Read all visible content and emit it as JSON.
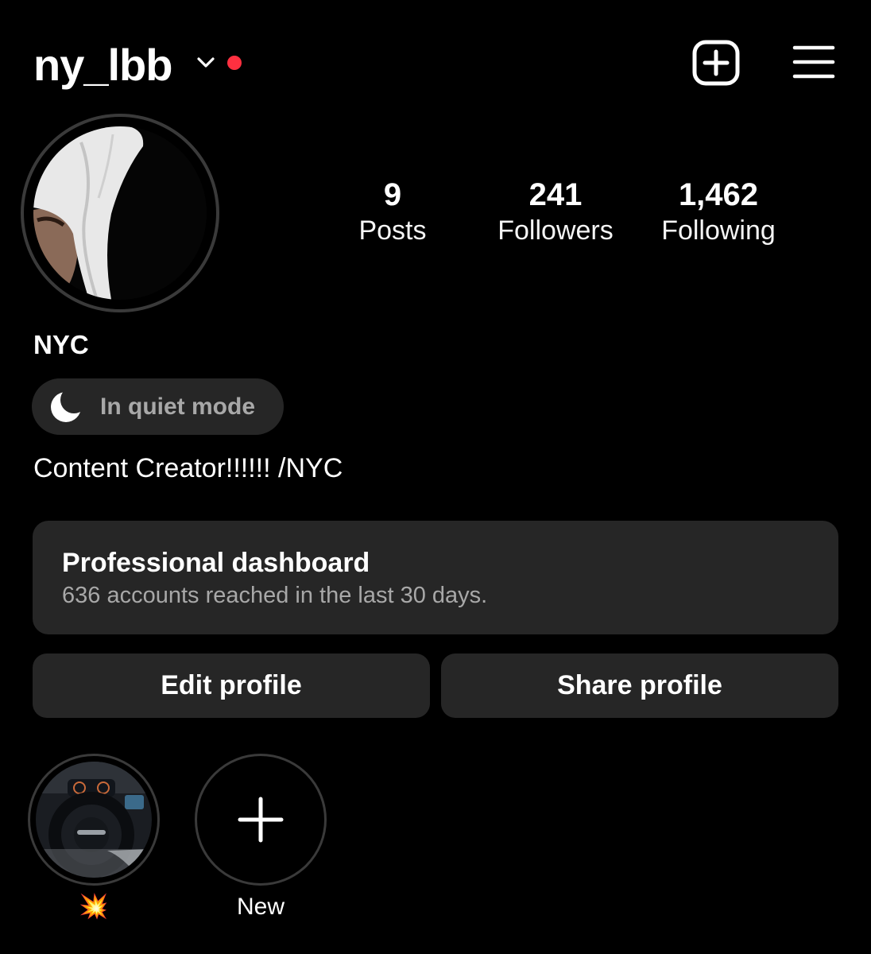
{
  "header": {
    "username": "ny_lbb",
    "accent_dot_color": "#ff3040",
    "new_post_icon": "plus-square-icon",
    "menu_icon": "hamburger-menu-icon"
  },
  "profile": {
    "display_name": "NYC",
    "quiet_mode_label": "In quiet mode",
    "bio": "Content Creator!!!!!! /NYC"
  },
  "stats": [
    {
      "value": "9",
      "label": "Posts"
    },
    {
      "value": "241",
      "label": "Followers"
    },
    {
      "value": "1,462",
      "label": "Following"
    }
  ],
  "dashboard": {
    "title": "Professional dashboard",
    "subtitle": "636 accounts reached in the last 30 days."
  },
  "actions": {
    "edit_label": "Edit profile",
    "share_label": "Share profile"
  },
  "highlights": [
    {
      "label": "💥"
    },
    {
      "label": "New"
    }
  ]
}
